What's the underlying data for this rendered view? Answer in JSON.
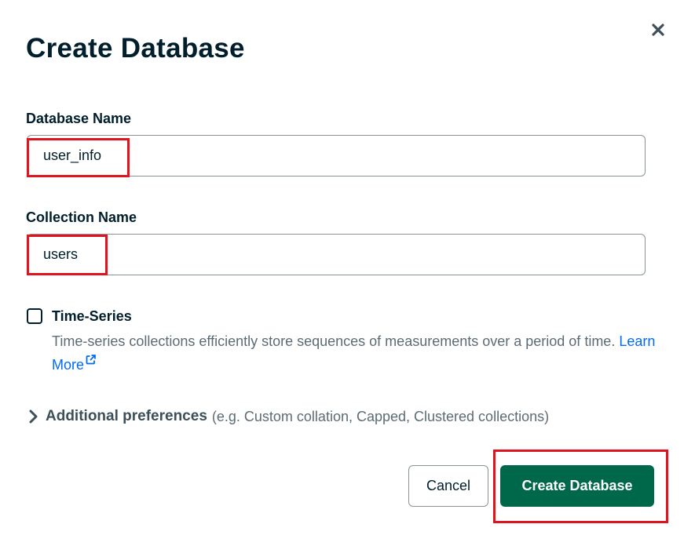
{
  "dialog": {
    "title": "Create Database",
    "close_icon": "close-icon"
  },
  "database_name": {
    "label": "Database Name",
    "value": "user_info"
  },
  "collection_name": {
    "label": "Collection Name",
    "value": "users"
  },
  "time_series": {
    "label": "Time-Series",
    "checked": false,
    "description": "Time-series collections efficiently store sequences of measurements over a period of time.",
    "learn_more": "Learn More"
  },
  "additional_preferences": {
    "title": "Additional preferences",
    "hint": "(e.g. Custom collation, Capped, Clustered collections)"
  },
  "actions": {
    "cancel_label": "Cancel",
    "create_label": "Create Database"
  },
  "colors": {
    "primary": "#00684a",
    "link": "#016bf8",
    "highlight": "#e0141e",
    "text": "#001e2b"
  }
}
